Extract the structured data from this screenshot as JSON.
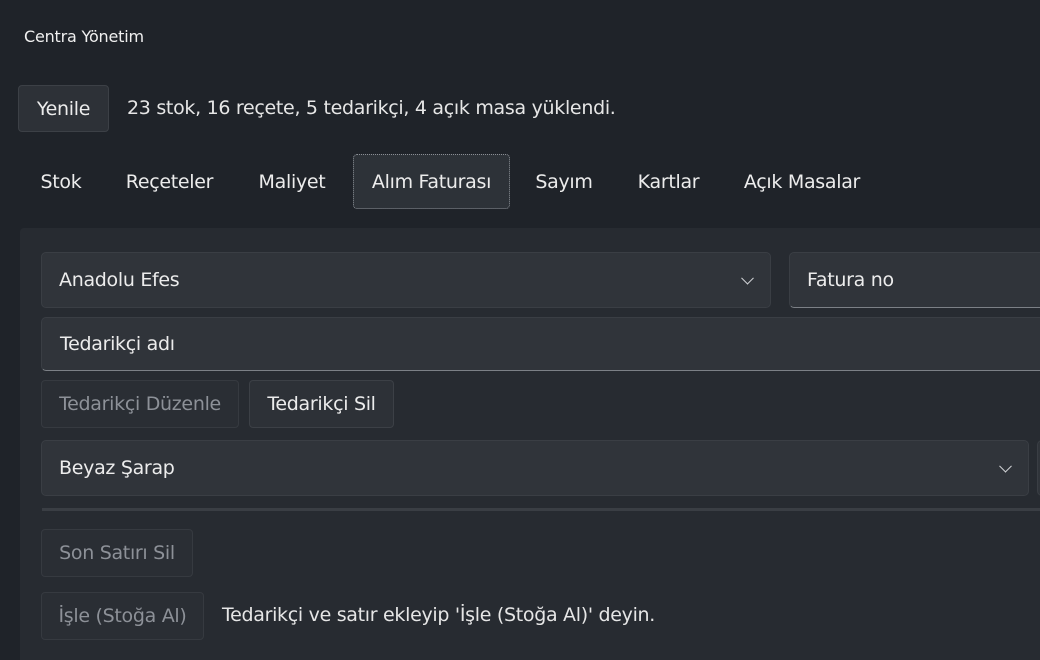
{
  "window": {
    "title": "Centra Yönetim"
  },
  "toolbar": {
    "refresh_label": "Yenile",
    "status_text": "23 stok, 16 reçete, 5 tedarikçi, 4 açık masa yüklendi."
  },
  "tabs": [
    {
      "label": "Stok",
      "active": false
    },
    {
      "label": "Reçeteler",
      "active": false
    },
    {
      "label": "Maliyet",
      "active": false
    },
    {
      "label": "Alım Faturası",
      "active": true
    },
    {
      "label": "Sayım",
      "active": false
    },
    {
      "label": "Kartlar",
      "active": false
    },
    {
      "label": "Açık Masalar",
      "active": false
    }
  ],
  "purchase_invoice": {
    "supplier_select_value": "Anadolu Efes",
    "invoice_no_placeholder": "Fatura no",
    "supplier_name_placeholder": "Tedarikçi adı",
    "edit_supplier_label": "Tedarikçi Düzenle",
    "delete_supplier_label": "Tedarikçi Sil",
    "item_select_value": "Beyaz Şarap",
    "delete_last_row_label": "Son Satırı Sil",
    "process_label": "İşle (Stoğa Al)",
    "hint_text": "Tedarikçi ve satır ekleyip 'İşle (Stoğa Al)' deyin."
  },
  "icons": {
    "dropdown": "chevron-down-icon"
  }
}
